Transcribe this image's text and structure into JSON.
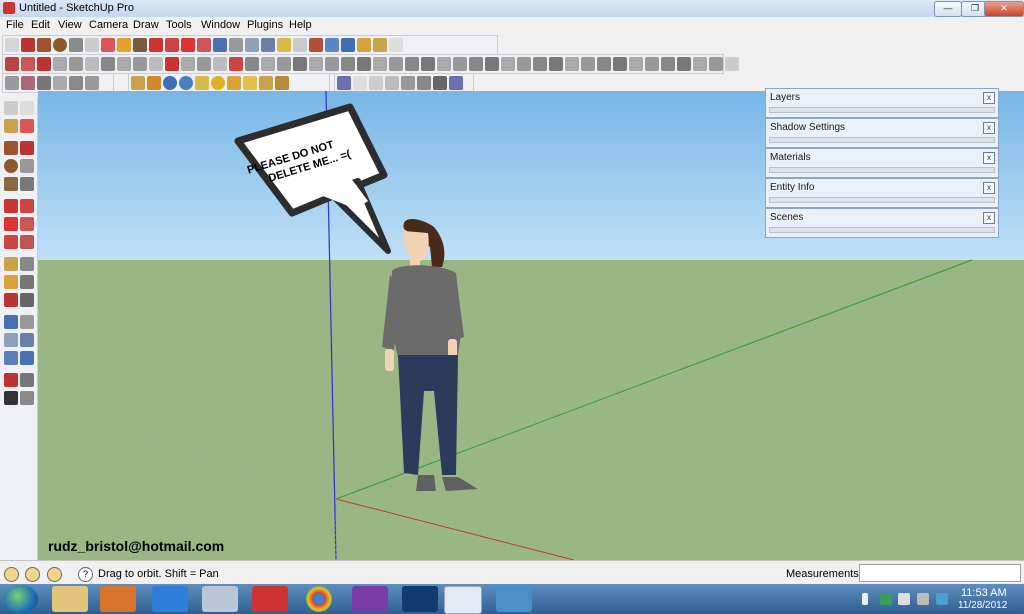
{
  "window": {
    "title": "Untitled - SketchUp Pro",
    "min": "—",
    "max": "❐",
    "close": "✕"
  },
  "menu": [
    "File",
    "Edit",
    "View",
    "Camera",
    "Draw",
    "Tools",
    "Window",
    "Plugins",
    "Help"
  ],
  "trays": [
    {
      "title": "Layers",
      "close": "x"
    },
    {
      "title": "Shadow Settings",
      "close": "x"
    },
    {
      "title": "Materials",
      "close": "x"
    },
    {
      "title": "Entity Info",
      "close": "x"
    },
    {
      "title": "Scenes",
      "close": "x"
    }
  ],
  "speech_bubble": {
    "line1": "PLEASE DO NOT",
    "line2": "DELETE ME... =("
  },
  "watermark": "rudz_bristol@hotmail.com",
  "status": {
    "hint": "Drag to orbit.  Shift = Pan",
    "measurements_label": "Measurements",
    "measurements_value": "",
    "help": "?"
  },
  "clock": {
    "time": "11:53 AM",
    "date": "11/28/2012"
  },
  "colors": {
    "sky_top": "#78b6e6",
    "ground": "#99b784",
    "axis_blue": "#2b35c9",
    "axis_green": "#2e9e2e",
    "axis_red": "#c8362b"
  }
}
